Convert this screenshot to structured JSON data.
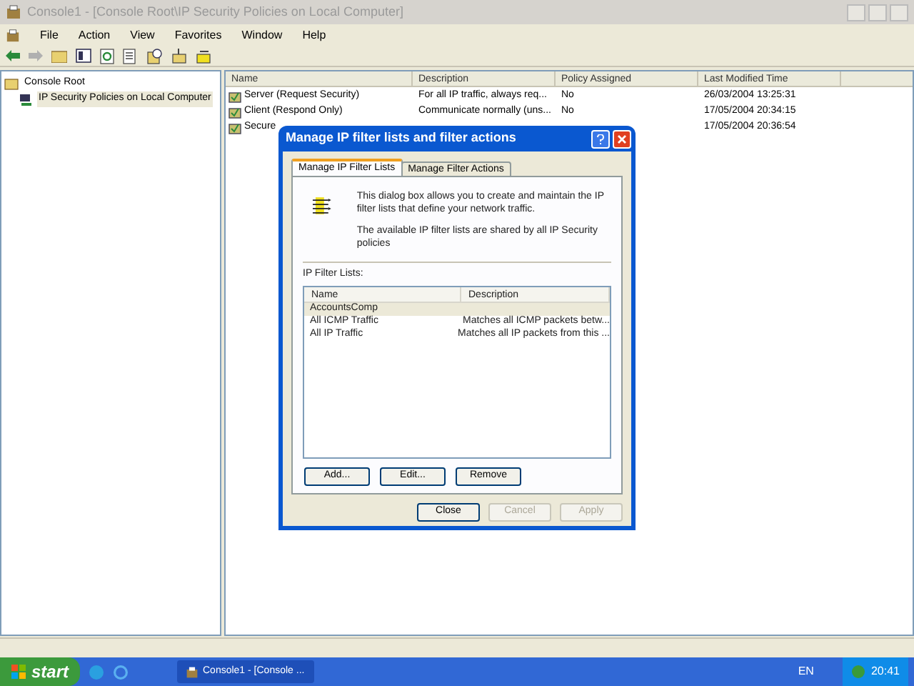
{
  "window": {
    "title": "Console1 - [Console Root\\IP Security Policies on Local Computer]"
  },
  "menu": [
    "File",
    "Action",
    "View",
    "Favorites",
    "Window",
    "Help"
  ],
  "tree": [
    {
      "label": "Console Root",
      "selected": false,
      "children": [
        {
          "label": "IP Security Policies on Local Computer",
          "selected": true
        }
      ]
    }
  ],
  "table": {
    "columns": [
      "Name",
      "Description",
      "Policy Assigned",
      "Last Modified Time"
    ],
    "rows": [
      {
        "cells": [
          "Server (Request Security)",
          "For all IP traffic, always req...",
          "No",
          "26/03/2004 13:25:31"
        ]
      },
      {
        "cells": [
          "Client (Respond Only)",
          "Communicate normally (uns...",
          "No",
          "17/05/2004 20:34:15"
        ]
      },
      {
        "cells": [
          "Secure",
          "",
          "",
          "17/05/2004 20:36:54"
        ]
      }
    ]
  },
  "dialog": {
    "title": "Manage IP filter lists and filter actions",
    "tabs": [
      {
        "label": "Manage IP Filter Lists",
        "selected": true
      },
      {
        "label": "Manage Filter Actions",
        "selected": false
      }
    ],
    "intro": "This dialog box allows you to create and maintain the IP filter lists that define your network traffic.",
    "note": "The available IP filter lists are shared by all IP Security policies",
    "list_label": "IP Filter Lists:",
    "list": {
      "columns": [
        "Name",
        "Description"
      ],
      "rows": [
        {
          "name": "AccountsComp",
          "description": "",
          "selected": true
        },
        {
          "name": "All ICMP Traffic",
          "description": "Matches all ICMP packets betw...",
          "selected": false
        },
        {
          "name": "All IP Traffic",
          "description": "Matches all IP packets from this ...",
          "selected": false
        }
      ]
    },
    "list_buttons": [
      {
        "label": "Add...",
        "disabled": false
      },
      {
        "label": "Edit...",
        "disabled": false
      },
      {
        "label": "Remove",
        "disabled": false
      }
    ],
    "buttons": [
      {
        "label": "Close",
        "disabled": false
      },
      {
        "label": "Cancel",
        "disabled": true
      },
      {
        "label": "Apply",
        "disabled": true
      }
    ]
  },
  "taskbar": {
    "start": "start",
    "tasks": [
      "Console1 - [Console ..."
    ],
    "language": "EN",
    "clock": "20:41"
  }
}
